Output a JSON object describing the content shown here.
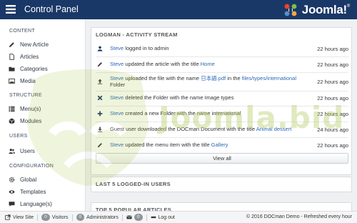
{
  "header": {
    "title": "Control Panel",
    "brand": "Joomla!",
    "brand_mark": "®"
  },
  "sidebar": {
    "sections": [
      {
        "heading": "CONTENT",
        "items": [
          {
            "label": "New Article",
            "icon": "pencil-icon"
          },
          {
            "label": "Articles",
            "icon": "document-icon"
          },
          {
            "label": "Categories",
            "icon": "folder-icon"
          },
          {
            "label": "Media",
            "icon": "image-icon"
          }
        ]
      },
      {
        "heading": "STRUCTURE",
        "items": [
          {
            "label": "Menu(s)",
            "icon": "list-icon"
          },
          {
            "label": "Modules",
            "icon": "cube-icon"
          }
        ]
      },
      {
        "heading": "USERS",
        "items": [
          {
            "label": "Users",
            "icon": "users-icon"
          }
        ]
      },
      {
        "heading": "CONFIGURATION",
        "items": [
          {
            "label": "Global",
            "icon": "gear-icon"
          },
          {
            "label": "Templates",
            "icon": "eye-icon"
          },
          {
            "label": "Language(s)",
            "icon": "comment-icon"
          }
        ]
      }
    ]
  },
  "watermark": {
    "text": "Joomla.bid"
  },
  "activity": {
    "title": "LOGMAN - ACTIVITY STREAM",
    "rows": [
      {
        "icon": "user-icon",
        "actor": "Steve",
        "text": " logged in to admin",
        "link": "",
        "text2": "",
        "link2": "",
        "text3": "",
        "time": "22 hours ago"
      },
      {
        "icon": "pencil-icon",
        "actor": "Steve",
        "text": " updated the article with the title ",
        "link": "Home",
        "text2": "",
        "link2": "",
        "text3": "",
        "time": "22 hours ago"
      },
      {
        "icon": "upload-icon",
        "actor": "Steve",
        "text": " uploaded the file with the name ",
        "link": "日本語.pdf",
        "text2": " in the ",
        "link2": "files/types/international",
        "text3": " Folder",
        "time": "22 hours ago"
      },
      {
        "icon": "delete-icon",
        "actor": "Steve",
        "text": " deleted the Folder with the name Image types",
        "link": "",
        "text2": "",
        "link2": "",
        "text3": "",
        "time": "22 hours ago"
      },
      {
        "icon": "plus-icon",
        "actor": "Steve",
        "text": " created a new Folder with the name international",
        "link": "",
        "text2": "",
        "link2": "",
        "text3": "",
        "time": "22 hours ago"
      },
      {
        "icon": "download-icon",
        "actor": "",
        "text": "Guest user downloaded the DOCman Document with the title ",
        "link": "Animal dessert",
        "text2": "",
        "link2": "",
        "text3": "",
        "time": "24 hours ago"
      },
      {
        "icon": "pencil-icon",
        "actor": "Steve",
        "text": " updated the menu item with the title ",
        "link": "Gallery",
        "text2": "",
        "link2": "",
        "text3": "",
        "time": "22 hours ago"
      }
    ],
    "view_all": "View all"
  },
  "logged_in": {
    "title": "LAST 5 LOGGED-IN USERS"
  },
  "popular": {
    "title": "TOP 5 POPULAR ARTICLES"
  },
  "footer": {
    "view_site": "View Site",
    "visitors_count": "0",
    "visitors_label": "Visitors",
    "admins_count": "0",
    "admins_label": "Administrators",
    "messages_count": "0",
    "logout": "Log out",
    "copyright": "© 2016 DOCman Demo - Refreshed every hour"
  },
  "colors": {
    "header_bg": "#1a3867",
    "link": "#2a69b8",
    "brand_orange": "#f44321",
    "brand_green": "#7ac143",
    "brand_blue": "#5091cd",
    "brand_yellow": "#f9a541"
  }
}
